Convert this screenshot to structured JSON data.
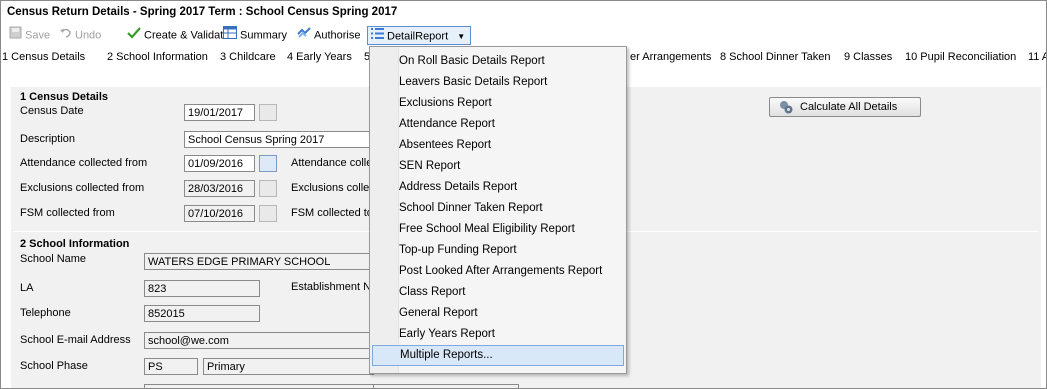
{
  "window": {
    "title": "Census Return Details - Spring 2017 Term : School Census Spring 2017"
  },
  "toolbar": {
    "save": "Save",
    "undo": "Undo",
    "create_validate": "Create & Validate",
    "summary": "Summary",
    "authorise": "Authorise",
    "detail_report": "DetailReport"
  },
  "tabs": {
    "t1": "1 Census Details",
    "t2": "2 School Information",
    "t3": "3 Childcare",
    "t4": "4 Early Years",
    "t5": "5",
    "t7": "er Arrangements",
    "t8": "8 School Dinner Taken",
    "t9": "9 Classes",
    "t10": "10 Pupil Reconciliation",
    "t11": "11 A"
  },
  "census": {
    "title": "1 Census Details",
    "census_date_label": "Census Date",
    "census_date": "19/01/2017",
    "description_label": "Description",
    "description": "School Census Spring 2017",
    "attendance_from_label": "Attendance collected from",
    "attendance_from": "01/09/2016",
    "attendance_to_label": "Attendance colle",
    "exclusions_from_label": "Exclusions collected from",
    "exclusions_from": "28/03/2016",
    "exclusions_to_label": "Exclusions colle",
    "fsm_from_label": "FSM collected from",
    "fsm_from": "07/10/2016",
    "fsm_to_label": "FSM collected to",
    "calc_button": "Calculate All Details"
  },
  "school": {
    "title": "2 School Information",
    "name_label": "School Name",
    "name": "WATERS EDGE PRIMARY SCHOOL",
    "la_label": "LA",
    "la": "823",
    "establishment_label": "Establishment N",
    "telephone_label": "Telephone",
    "telephone": "852015",
    "email_label": "School E-mail Address",
    "email": "school@we.com",
    "phase_label": "School Phase",
    "phase_code": "PS",
    "phase": "Primary"
  },
  "report_menu": {
    "items": [
      "On Roll Basic Details Report",
      "Leavers Basic Details Report",
      "Exclusions Report",
      "Attendance Report",
      "Absentees Report",
      "SEN Report",
      "Address Details Report",
      "School Dinner Taken Report",
      "Free School Meal Eligibility Report",
      "Top-up Funding Report",
      "Post Looked After Arrangements Report",
      "Class Report",
      "General Report",
      "Early Years Report",
      "Multiple Reports..."
    ],
    "highlighted": "Multiple Reports..."
  },
  "colors": {
    "menu_highlight": "#d9e8f9",
    "panel_bg": "#f1f1f1",
    "accent": "#3a7bd5"
  }
}
